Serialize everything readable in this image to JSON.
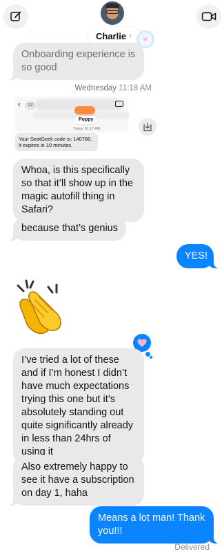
{
  "header": {
    "contact_name": "Charlie",
    "chevron": "›"
  },
  "thread": {
    "messages": [
      {
        "dir": "in",
        "text": "Onboarding experience is so good"
      },
      {
        "dir": "in",
        "text": "Whoa, is this specifically so that it’ll show up in the magic autofill thing in Safari?"
      },
      {
        "dir": "in",
        "text": "because that’s genius"
      },
      {
        "dir": "out",
        "text": "YES!"
      },
      {
        "dir": "in",
        "text": "I’ve tried a lot of these and if I’m honest I didn’t have much expectations trying this one but it’s absolutely standing out quite significantly already in less than 24hrs of using it"
      },
      {
        "dir": "in",
        "text": "Also extremely happy to see it have a subscription on day 1, haha"
      },
      {
        "dir": "out",
        "text": "Means a lot man! Thank you!!!"
      }
    ],
    "timestamp_day": "Wednesday",
    "timestamp_time": "11:18 AM",
    "status": "Delivered"
  },
  "screenshot_attachment": {
    "badge": "12",
    "contact": "Poppy",
    "today_time": "Today 10:17 AM",
    "code_text": "Your SeatGeek code is: 140788. It expires in 10 minutes."
  },
  "icons": {
    "compose": "compose-icon",
    "video": "video-call-icon",
    "save": "save-download-icon",
    "clapping": "clapping-hands-emoji",
    "heart": "heart-tapback-icon"
  },
  "colors": {
    "outgoing": "#0a84ff",
    "incoming": "#e9e9eb",
    "timestamp": "#8a8a8e"
  }
}
